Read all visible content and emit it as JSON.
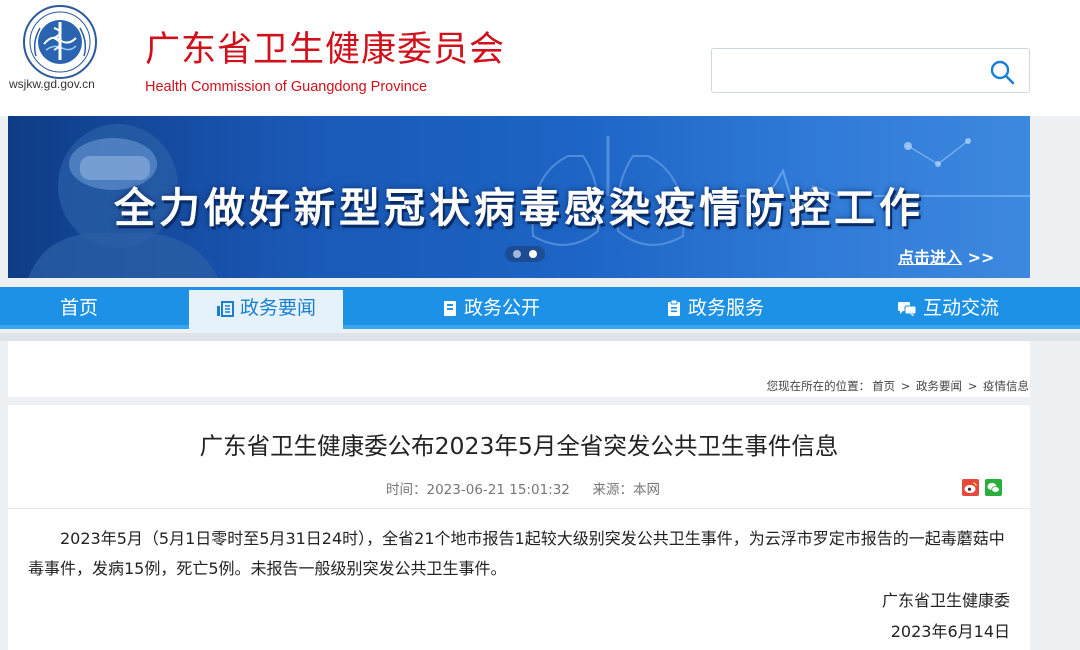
{
  "header": {
    "domain": "wsjkw.gd.gov.cn",
    "title_cn": "广东省卫生健康委员会",
    "title_en": "Health Commission of Guangdong Province",
    "search_placeholder": ""
  },
  "banner": {
    "slogan": "全力做好新型冠状病毒感染疫情防控工作",
    "enter_label": "点击进入",
    "enter_arrows": ">>",
    "slides_count": 2,
    "active_slide": 2
  },
  "nav": {
    "items": [
      {
        "label": "首页",
        "icon": ""
      },
      {
        "label": "政务要闻",
        "icon": "news-icon",
        "active": true
      },
      {
        "label": "政务公开",
        "icon": "document-icon"
      },
      {
        "label": "政务服务",
        "icon": "service-icon"
      },
      {
        "label": "互动交流",
        "icon": "chat-icon"
      }
    ]
  },
  "breadcrumb": {
    "prefix": "您现在所在的位置：",
    "items": [
      "首页",
      "政务要闻",
      "疫情信息"
    ],
    "separator": ">"
  },
  "article": {
    "title": "广东省卫生健康委公布2023年5月全省突发公共卫生事件信息",
    "time_label": "时间：",
    "time_value": "2023-06-21 15:01:32",
    "source_label": "来源：",
    "source_value": "本网",
    "body": "2023年5月（5月1日零时至5月31日24时），全省21个地市报告1起较大级别突发公共卫生事件，为云浮市罗定市报告的一起毒蘑菇中毒事件，发病15例，死亡5例。未报告一般级别突发公共卫生事件。",
    "sign_org": "广东省卫生健康委",
    "sign_date": "2023年6月14日"
  },
  "colors": {
    "brand_red": "#d0111b",
    "nav_blue": "#1c91e5",
    "banner_blue": "#1d64c4"
  }
}
